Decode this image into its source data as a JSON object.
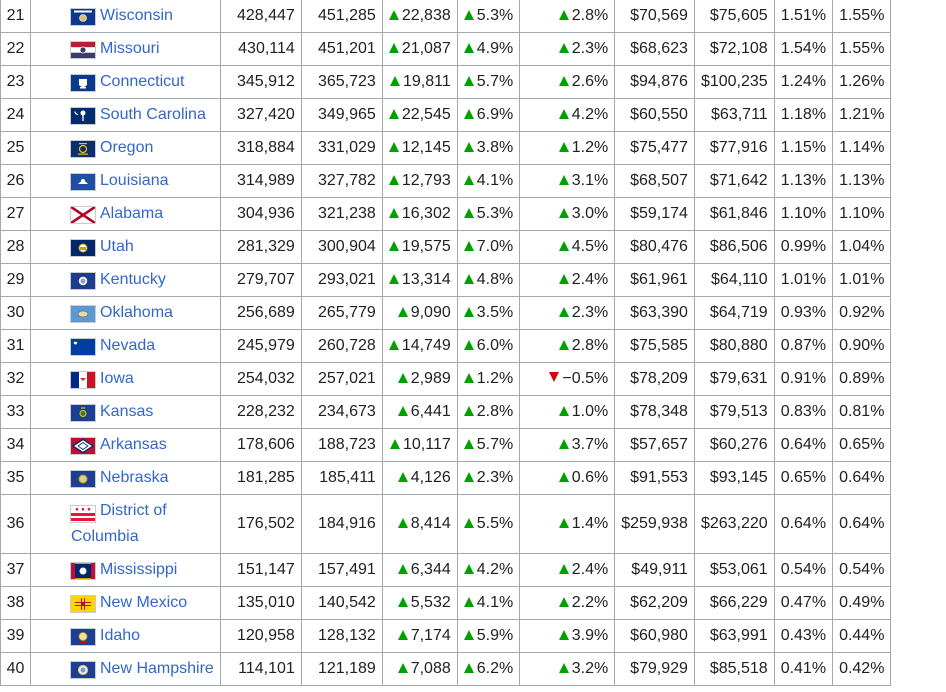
{
  "colors": {
    "link": "#3366cc",
    "increase": "#00a000",
    "decrease": "#dd0000",
    "border": "#a2a9b1"
  },
  "rows": [
    {
      "rank": "21",
      "state": "Wisconsin",
      "flag": "flag-wisconsin-icon",
      "v1": "428,447",
      "v2": "451,285",
      "change": "22,838",
      "pct": "5.3%",
      "growth": "2.8%",
      "growth_dir": "up",
      "g1": "$70,569",
      "g2": "$75,605",
      "s1": "1.51%",
      "s2": "1.55%"
    },
    {
      "rank": "22",
      "state": "Missouri",
      "flag": "flag-missouri-icon",
      "v1": "430,114",
      "v2": "451,201",
      "change": "21,087",
      "pct": "4.9%",
      "growth": "2.3%",
      "growth_dir": "up",
      "g1": "$68,623",
      "g2": "$72,108",
      "s1": "1.54%",
      "s2": "1.55%"
    },
    {
      "rank": "23",
      "state": "Connecticut",
      "flag": "flag-connecticut-icon",
      "v1": "345,912",
      "v2": "365,723",
      "change": "19,811",
      "pct": "5.7%",
      "growth": "2.6%",
      "growth_dir": "up",
      "g1": "$94,876",
      "g2": "$100,235",
      "s1": "1.24%",
      "s2": "1.26%"
    },
    {
      "rank": "24",
      "state": "South Carolina",
      "flag": "flag-south-carolina-icon",
      "v1": "327,420",
      "v2": "349,965",
      "change": "22,545",
      "pct": "6.9%",
      "growth": "4.2%",
      "growth_dir": "up",
      "g1": "$60,550",
      "g2": "$63,711",
      "s1": "1.18%",
      "s2": "1.21%"
    },
    {
      "rank": "25",
      "state": "Oregon",
      "flag": "flag-oregon-icon",
      "v1": "318,884",
      "v2": "331,029",
      "change": "12,145",
      "pct": "3.8%",
      "growth": "1.2%",
      "growth_dir": "up",
      "g1": "$75,477",
      "g2": "$77,916",
      "s1": "1.15%",
      "s2": "1.14%"
    },
    {
      "rank": "26",
      "state": "Louisiana",
      "flag": "flag-louisiana-icon",
      "v1": "314,989",
      "v2": "327,782",
      "change": "12,793",
      "pct": "4.1%",
      "growth": "3.1%",
      "growth_dir": "up",
      "g1": "$68,507",
      "g2": "$71,642",
      "s1": "1.13%",
      "s2": "1.13%"
    },
    {
      "rank": "27",
      "state": "Alabama",
      "flag": "flag-alabama-icon",
      "v1": "304,936",
      "v2": "321,238",
      "change": "16,302",
      "pct": "5.3%",
      "growth": "3.0%",
      "growth_dir": "up",
      "g1": "$59,174",
      "g2": "$61,846",
      "s1": "1.10%",
      "s2": "1.10%"
    },
    {
      "rank": "28",
      "state": "Utah",
      "flag": "flag-utah-icon",
      "v1": "281,329",
      "v2": "300,904",
      "change": "19,575",
      "pct": "7.0%",
      "growth": "4.5%",
      "growth_dir": "up",
      "g1": "$80,476",
      "g2": "$86,506",
      "s1": "0.99%",
      "s2": "1.04%"
    },
    {
      "rank": "29",
      "state": "Kentucky",
      "flag": "flag-kentucky-icon",
      "v1": "279,707",
      "v2": "293,021",
      "change": "13,314",
      "pct": "4.8%",
      "growth": "2.4%",
      "growth_dir": "up",
      "g1": "$61,961",
      "g2": "$64,110",
      "s1": "1.01%",
      "s2": "1.01%"
    },
    {
      "rank": "30",
      "state": "Oklahoma",
      "flag": "flag-oklahoma-icon",
      "v1": "256,689",
      "v2": "265,779",
      "change": "9,090",
      "pct": "3.5%",
      "growth": "2.3%",
      "growth_dir": "up",
      "g1": "$63,390",
      "g2": "$64,719",
      "s1": "0.93%",
      "s2": "0.92%"
    },
    {
      "rank": "31",
      "state": "Nevada",
      "flag": "flag-nevada-icon",
      "v1": "245,979",
      "v2": "260,728",
      "change": "14,749",
      "pct": "6.0%",
      "growth": "2.8%",
      "growth_dir": "up",
      "g1": "$75,585",
      "g2": "$80,880",
      "s1": "0.87%",
      "s2": "0.90%"
    },
    {
      "rank": "32",
      "state": "Iowa",
      "flag": "flag-iowa-icon",
      "v1": "254,032",
      "v2": "257,021",
      "change": "2,989",
      "pct": "1.2%",
      "growth": "−0.5%",
      "growth_dir": "down",
      "g1": "$78,209",
      "g2": "$79,631",
      "s1": "0.91%",
      "s2": "0.89%"
    },
    {
      "rank": "33",
      "state": "Kansas",
      "flag": "flag-kansas-icon",
      "v1": "228,232",
      "v2": "234,673",
      "change": "6,441",
      "pct": "2.8%",
      "growth": "1.0%",
      "growth_dir": "up",
      "g1": "$78,348",
      "g2": "$79,513",
      "s1": "0.83%",
      "s2": "0.81%"
    },
    {
      "rank": "34",
      "state": "Arkansas",
      "flag": "flag-arkansas-icon",
      "v1": "178,606",
      "v2": "188,723",
      "change": "10,117",
      "pct": "5.7%",
      "growth": "3.7%",
      "growth_dir": "up",
      "g1": "$57,657",
      "g2": "$60,276",
      "s1": "0.64%",
      "s2": "0.65%"
    },
    {
      "rank": "35",
      "state": "Nebraska",
      "flag": "flag-nebraska-icon",
      "v1": "181,285",
      "v2": "185,411",
      "change": "4,126",
      "pct": "2.3%",
      "growth": "0.6%",
      "growth_dir": "up",
      "g1": "$91,553",
      "g2": "$93,145",
      "s1": "0.65%",
      "s2": "0.64%"
    },
    {
      "rank": "36",
      "state": "District of Columbia",
      "flag": "flag-district-of-columbia-icon",
      "tall": true,
      "v1": "176,502",
      "v2": "184,916",
      "change": "8,414",
      "pct": "5.5%",
      "growth": "1.4%",
      "growth_dir": "up",
      "g1": "$259,938",
      "g2": "$263,220",
      "s1": "0.64%",
      "s2": "0.64%"
    },
    {
      "rank": "37",
      "state": "Mississippi",
      "flag": "flag-mississippi-icon",
      "v1": "151,147",
      "v2": "157,491",
      "change": "6,344",
      "pct": "4.2%",
      "growth": "2.4%",
      "growth_dir": "up",
      "g1": "$49,911",
      "g2": "$53,061",
      "s1": "0.54%",
      "s2": "0.54%"
    },
    {
      "rank": "38",
      "state": "New Mexico",
      "flag": "flag-new-mexico-icon",
      "v1": "135,010",
      "v2": "140,542",
      "change": "5,532",
      "pct": "4.1%",
      "growth": "2.2%",
      "growth_dir": "up",
      "g1": "$62,209",
      "g2": "$66,229",
      "s1": "0.47%",
      "s2": "0.49%"
    },
    {
      "rank": "39",
      "state": "Idaho",
      "flag": "flag-idaho-icon",
      "v1": "120,958",
      "v2": "128,132",
      "change": "7,174",
      "pct": "5.9%",
      "growth": "3.9%",
      "growth_dir": "up",
      "g1": "$60,980",
      "g2": "$63,991",
      "s1": "0.43%",
      "s2": "0.44%"
    },
    {
      "rank": "40",
      "state": "New Hampshire",
      "flag": "flag-new-hampshire-icon",
      "v1": "114,101",
      "v2": "121,189",
      "change": "7,088",
      "pct": "6.2%",
      "growth": "3.2%",
      "growth_dir": "up",
      "g1": "$79,929",
      "g2": "$85,518",
      "s1": "0.41%",
      "s2": "0.42%"
    }
  ]
}
